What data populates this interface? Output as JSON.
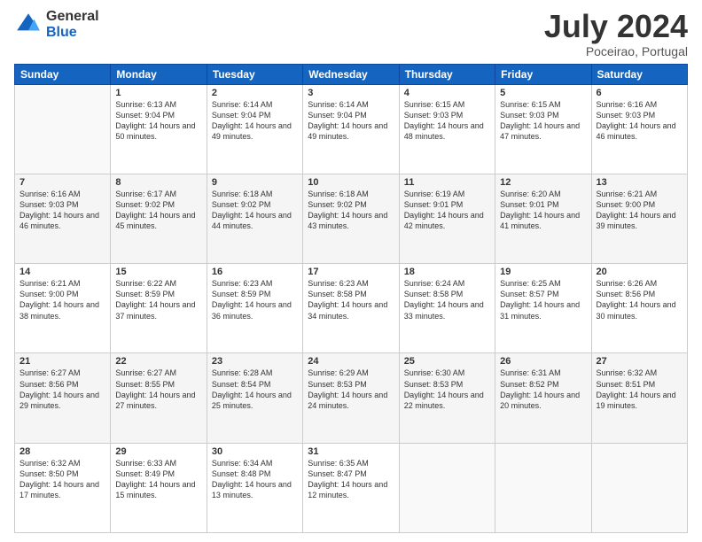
{
  "logo": {
    "general": "General",
    "blue": "Blue"
  },
  "header": {
    "month_year": "July 2024",
    "location": "Poceirao, Portugal"
  },
  "days_of_week": [
    "Sunday",
    "Monday",
    "Tuesday",
    "Wednesday",
    "Thursday",
    "Friday",
    "Saturday"
  ],
  "weeks": [
    [
      {
        "day": "",
        "sunrise": "",
        "sunset": "",
        "daylight": ""
      },
      {
        "day": "1",
        "sunrise": "Sunrise: 6:13 AM",
        "sunset": "Sunset: 9:04 PM",
        "daylight": "Daylight: 14 hours and 50 minutes."
      },
      {
        "day": "2",
        "sunrise": "Sunrise: 6:14 AM",
        "sunset": "Sunset: 9:04 PM",
        "daylight": "Daylight: 14 hours and 49 minutes."
      },
      {
        "day": "3",
        "sunrise": "Sunrise: 6:14 AM",
        "sunset": "Sunset: 9:04 PM",
        "daylight": "Daylight: 14 hours and 49 minutes."
      },
      {
        "day": "4",
        "sunrise": "Sunrise: 6:15 AM",
        "sunset": "Sunset: 9:03 PM",
        "daylight": "Daylight: 14 hours and 48 minutes."
      },
      {
        "day": "5",
        "sunrise": "Sunrise: 6:15 AM",
        "sunset": "Sunset: 9:03 PM",
        "daylight": "Daylight: 14 hours and 47 minutes."
      },
      {
        "day": "6",
        "sunrise": "Sunrise: 6:16 AM",
        "sunset": "Sunset: 9:03 PM",
        "daylight": "Daylight: 14 hours and 46 minutes."
      }
    ],
    [
      {
        "day": "7",
        "sunrise": "Sunrise: 6:16 AM",
        "sunset": "Sunset: 9:03 PM",
        "daylight": "Daylight: 14 hours and 46 minutes."
      },
      {
        "day": "8",
        "sunrise": "Sunrise: 6:17 AM",
        "sunset": "Sunset: 9:02 PM",
        "daylight": "Daylight: 14 hours and 45 minutes."
      },
      {
        "day": "9",
        "sunrise": "Sunrise: 6:18 AM",
        "sunset": "Sunset: 9:02 PM",
        "daylight": "Daylight: 14 hours and 44 minutes."
      },
      {
        "day": "10",
        "sunrise": "Sunrise: 6:18 AM",
        "sunset": "Sunset: 9:02 PM",
        "daylight": "Daylight: 14 hours and 43 minutes."
      },
      {
        "day": "11",
        "sunrise": "Sunrise: 6:19 AM",
        "sunset": "Sunset: 9:01 PM",
        "daylight": "Daylight: 14 hours and 42 minutes."
      },
      {
        "day": "12",
        "sunrise": "Sunrise: 6:20 AM",
        "sunset": "Sunset: 9:01 PM",
        "daylight": "Daylight: 14 hours and 41 minutes."
      },
      {
        "day": "13",
        "sunrise": "Sunrise: 6:21 AM",
        "sunset": "Sunset: 9:00 PM",
        "daylight": "Daylight: 14 hours and 39 minutes."
      }
    ],
    [
      {
        "day": "14",
        "sunrise": "Sunrise: 6:21 AM",
        "sunset": "Sunset: 9:00 PM",
        "daylight": "Daylight: 14 hours and 38 minutes."
      },
      {
        "day": "15",
        "sunrise": "Sunrise: 6:22 AM",
        "sunset": "Sunset: 8:59 PM",
        "daylight": "Daylight: 14 hours and 37 minutes."
      },
      {
        "day": "16",
        "sunrise": "Sunrise: 6:23 AM",
        "sunset": "Sunset: 8:59 PM",
        "daylight": "Daylight: 14 hours and 36 minutes."
      },
      {
        "day": "17",
        "sunrise": "Sunrise: 6:23 AM",
        "sunset": "Sunset: 8:58 PM",
        "daylight": "Daylight: 14 hours and 34 minutes."
      },
      {
        "day": "18",
        "sunrise": "Sunrise: 6:24 AM",
        "sunset": "Sunset: 8:58 PM",
        "daylight": "Daylight: 14 hours and 33 minutes."
      },
      {
        "day": "19",
        "sunrise": "Sunrise: 6:25 AM",
        "sunset": "Sunset: 8:57 PM",
        "daylight": "Daylight: 14 hours and 31 minutes."
      },
      {
        "day": "20",
        "sunrise": "Sunrise: 6:26 AM",
        "sunset": "Sunset: 8:56 PM",
        "daylight": "Daylight: 14 hours and 30 minutes."
      }
    ],
    [
      {
        "day": "21",
        "sunrise": "Sunrise: 6:27 AM",
        "sunset": "Sunset: 8:56 PM",
        "daylight": "Daylight: 14 hours and 29 minutes."
      },
      {
        "day": "22",
        "sunrise": "Sunrise: 6:27 AM",
        "sunset": "Sunset: 8:55 PM",
        "daylight": "Daylight: 14 hours and 27 minutes."
      },
      {
        "day": "23",
        "sunrise": "Sunrise: 6:28 AM",
        "sunset": "Sunset: 8:54 PM",
        "daylight": "Daylight: 14 hours and 25 minutes."
      },
      {
        "day": "24",
        "sunrise": "Sunrise: 6:29 AM",
        "sunset": "Sunset: 8:53 PM",
        "daylight": "Daylight: 14 hours and 24 minutes."
      },
      {
        "day": "25",
        "sunrise": "Sunrise: 6:30 AM",
        "sunset": "Sunset: 8:53 PM",
        "daylight": "Daylight: 14 hours and 22 minutes."
      },
      {
        "day": "26",
        "sunrise": "Sunrise: 6:31 AM",
        "sunset": "Sunset: 8:52 PM",
        "daylight": "Daylight: 14 hours and 20 minutes."
      },
      {
        "day": "27",
        "sunrise": "Sunrise: 6:32 AM",
        "sunset": "Sunset: 8:51 PM",
        "daylight": "Daylight: 14 hours and 19 minutes."
      }
    ],
    [
      {
        "day": "28",
        "sunrise": "Sunrise: 6:32 AM",
        "sunset": "Sunset: 8:50 PM",
        "daylight": "Daylight: 14 hours and 17 minutes."
      },
      {
        "day": "29",
        "sunrise": "Sunrise: 6:33 AM",
        "sunset": "Sunset: 8:49 PM",
        "daylight": "Daylight: 14 hours and 15 minutes."
      },
      {
        "day": "30",
        "sunrise": "Sunrise: 6:34 AM",
        "sunset": "Sunset: 8:48 PM",
        "daylight": "Daylight: 14 hours and 13 minutes."
      },
      {
        "day": "31",
        "sunrise": "Sunrise: 6:35 AM",
        "sunset": "Sunset: 8:47 PM",
        "daylight": "Daylight: 14 hours and 12 minutes."
      },
      {
        "day": "",
        "sunrise": "",
        "sunset": "",
        "daylight": ""
      },
      {
        "day": "",
        "sunrise": "",
        "sunset": "",
        "daylight": ""
      },
      {
        "day": "",
        "sunrise": "",
        "sunset": "",
        "daylight": ""
      }
    ]
  ]
}
